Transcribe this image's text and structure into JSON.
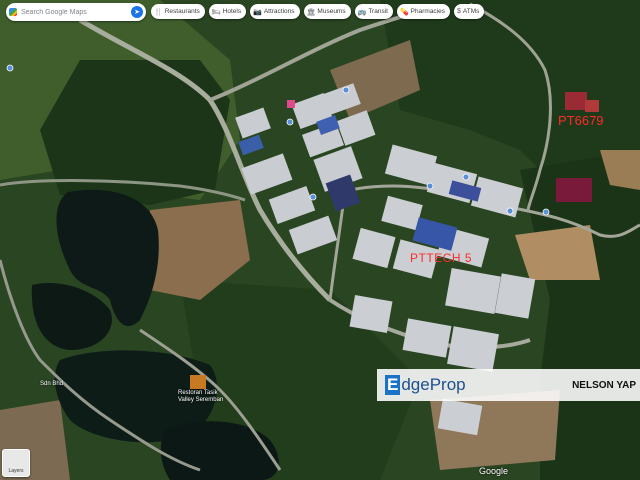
{
  "search": {
    "placeholder": "Search Google Maps"
  },
  "chips": [
    {
      "icon": "fork-knife-icon",
      "glyph": "🍴",
      "label": "Restaurants"
    },
    {
      "icon": "bed-icon",
      "glyph": "🛏",
      "label": "Hotels"
    },
    {
      "icon": "camera-icon",
      "glyph": "📷",
      "label": "Attractions"
    },
    {
      "icon": "museum-icon",
      "glyph": "🏛",
      "label": "Museums"
    },
    {
      "icon": "transit-icon",
      "glyph": "🚌",
      "label": "Transit"
    },
    {
      "icon": "pharmacy-icon",
      "glyph": "💊",
      "label": "Pharmacies"
    },
    {
      "icon": "atm-icon",
      "glyph": "$",
      "label": "ATMs"
    }
  ],
  "map_labels": {
    "site_name": "PTTECH 5",
    "plot_code": "PT6679",
    "restaurant": "Restoran Tasik\nValley Seremban",
    "company": "Sdn Bhd"
  },
  "banner": {
    "brand_initial": "E",
    "brand_rest": "dgeProp",
    "agent": "NELSON YAP"
  },
  "attribution": "Google",
  "layers_label": "Layers",
  "colors": {
    "annotation_red": "#ff2a2a",
    "brand_blue": "#1a73c7"
  }
}
